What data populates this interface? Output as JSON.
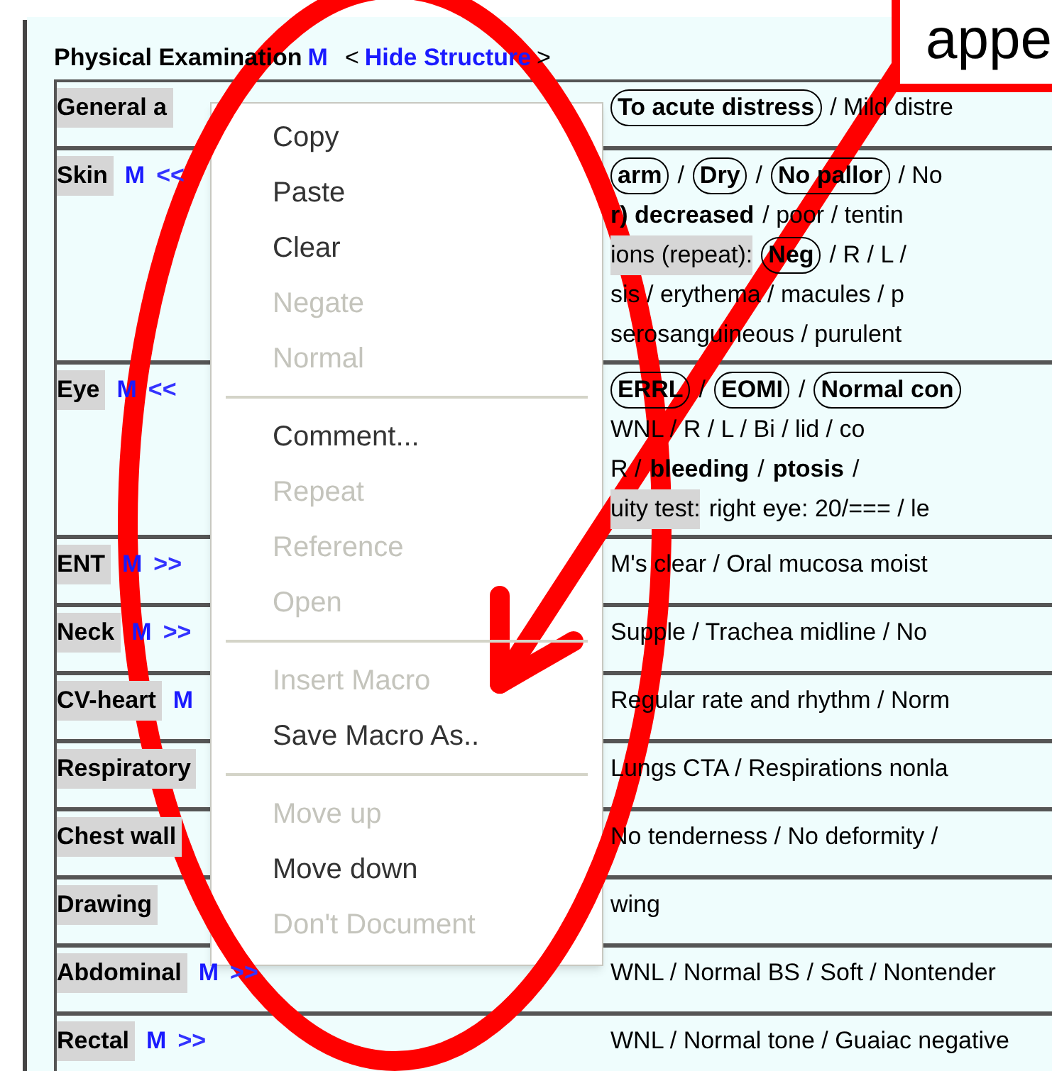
{
  "header": {
    "title": "Physical Examination",
    "marker": "M",
    "open_bracket": "<",
    "link": "Hide Structure",
    "close_bracket": ">"
  },
  "rows": [
    {
      "label": "General a",
      "marker": "",
      "toggle": "",
      "lines": [
        [
          {
            "kind": "circled",
            "text": "To acute distress"
          },
          {
            "kind": "plain",
            "text": "/ Mild distre"
          }
        ]
      ]
    },
    {
      "label": "Skin",
      "marker": "M",
      "toggle": "<<",
      "lines": [
        [
          {
            "kind": "circled",
            "text": "arm"
          },
          {
            "kind": "plain",
            "text": "/"
          },
          {
            "kind": "circled",
            "text": "Dry"
          },
          {
            "kind": "plain",
            "text": "/"
          },
          {
            "kind": "circled",
            "text": "No pallor"
          },
          {
            "kind": "plain",
            "text": "/ No"
          }
        ],
        [
          {
            "kind": "bold",
            "text": "r) decreased"
          },
          {
            "kind": "plain",
            "text": "/ poor / tentin"
          }
        ],
        [
          {
            "kind": "shaded",
            "text": "ions (repeat):"
          },
          {
            "kind": "circled",
            "text": "Neg"
          },
          {
            "kind": "plain",
            "text": "/ R / L /"
          }
        ],
        [
          {
            "kind": "plain",
            "text": "sis / erythema / macules / p"
          }
        ],
        [
          {
            "kind": "plain",
            "text": "serosanguineous / purulent"
          }
        ]
      ]
    },
    {
      "label": "Eye",
      "marker": "M",
      "toggle": "<<",
      "lines": [
        [
          {
            "kind": "circled",
            "text": "ERRL"
          },
          {
            "kind": "plain",
            "text": "/"
          },
          {
            "kind": "circled",
            "text": "EOMI"
          },
          {
            "kind": "plain",
            "text": "/"
          },
          {
            "kind": "circled",
            "text": "Normal con"
          }
        ],
        [
          {
            "kind": "plain",
            "text": "WNL / R / L / Bi / lid / co"
          }
        ],
        [
          {
            "kind": "plain",
            "text": "R /"
          },
          {
            "kind": "bold",
            "text": "bleeding"
          },
          {
            "kind": "plain",
            "text": "/"
          },
          {
            "kind": "bold",
            "text": "ptosis"
          },
          {
            "kind": "plain",
            "text": "/"
          }
        ],
        [
          {
            "kind": "shaded",
            "text": "uity test:"
          },
          {
            "kind": "plain",
            "text": "right eye: 20/=== / le"
          }
        ]
      ]
    },
    {
      "label": "ENT",
      "marker": "M",
      "toggle": ">>",
      "lines": [
        [
          {
            "kind": "plain",
            "text": "M's clear / Oral mucosa moist"
          }
        ]
      ]
    },
    {
      "label": "Neck",
      "marker": "M",
      "toggle": ">>",
      "lines": [
        [
          {
            "kind": "plain",
            "text": "Supple / Trachea midline / No"
          }
        ]
      ]
    },
    {
      "label": "CV-heart",
      "marker": "M",
      "toggle": "",
      "lines": [
        [
          {
            "kind": "plain",
            "text": "Regular rate and rhythm / Norm"
          }
        ]
      ]
    },
    {
      "label": "Respiratory",
      "marker": "",
      "toggle": "",
      "lines": [
        [
          {
            "kind": "plain",
            "text": "Lungs CTA / Respirations nonla"
          }
        ]
      ]
    },
    {
      "label": "Chest wall",
      "marker": "",
      "toggle": "",
      "lines": [
        [
          {
            "kind": "plain",
            "text": "No tenderness / No deformity /"
          }
        ]
      ]
    },
    {
      "label": "Drawing",
      "marker": "",
      "toggle": "",
      "lines": [
        [
          {
            "kind": "plain",
            "text": "wing"
          }
        ]
      ]
    },
    {
      "label": "Abdominal",
      "marker": "M",
      "toggle": ">>",
      "lines": [
        [
          {
            "kind": "plain",
            "text": "WNL / Normal BS / Soft / Nontender"
          }
        ]
      ]
    },
    {
      "label": "Rectal",
      "marker": "M",
      "toggle": ">>",
      "lines": [
        [
          {
            "kind": "plain",
            "text": "WNL / Normal tone / Guaiac negative"
          }
        ]
      ]
    }
  ],
  "context_menu": [
    [
      {
        "label": "Copy",
        "disabled": false
      },
      {
        "label": "Paste",
        "disabled": false
      },
      {
        "label": "Clear",
        "disabled": false
      },
      {
        "label": "Negate",
        "disabled": true
      },
      {
        "label": "Normal",
        "disabled": true
      }
    ],
    [
      {
        "label": "Comment...",
        "disabled": false
      },
      {
        "label": "Repeat",
        "disabled": true
      },
      {
        "label": "Reference",
        "disabled": true
      },
      {
        "label": "Open",
        "disabled": true
      }
    ],
    [
      {
        "label": "Insert Macro",
        "disabled": true
      },
      {
        "label": "Save Macro As..",
        "disabled": false
      }
    ],
    [
      {
        "label": "Move up",
        "disabled": true
      },
      {
        "label": "Move down",
        "disabled": false
      },
      {
        "label": "Don't Document",
        "disabled": true
      }
    ]
  ],
  "callout": {
    "text": "appe"
  }
}
